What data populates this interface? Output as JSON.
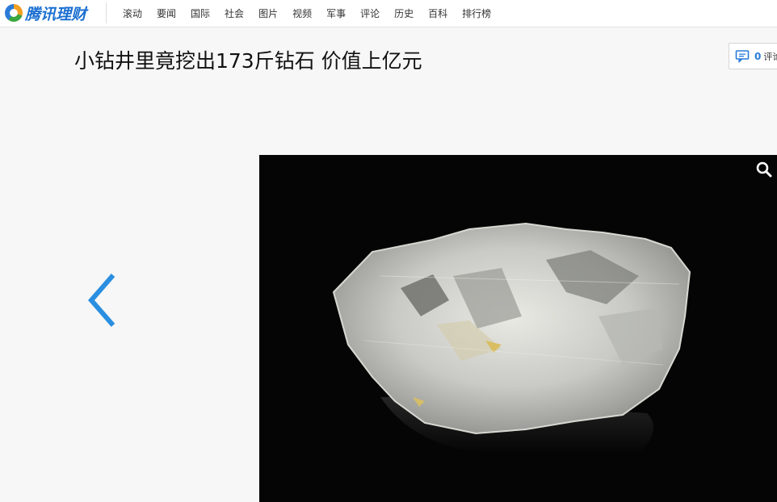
{
  "header": {
    "logo_text": "腾讯理财",
    "nav": [
      "滚动",
      "要闻",
      "国际",
      "社会",
      "图片",
      "视频",
      "军事",
      "评论",
      "历史",
      "百科",
      "排行榜"
    ]
  },
  "article": {
    "title": "小钻井里竟挖出173斤钻石 价值上亿元"
  },
  "comments": {
    "count": "0",
    "label": "评论"
  },
  "icons": {
    "comment": "comment-icon",
    "prev": "chevron-left-icon",
    "zoom": "search-icon"
  },
  "colors": {
    "brand_blue": "#1a6fd1",
    "arrow_blue": "#2a8fe0",
    "page_bg": "#f7f7f7",
    "photo_bg": "#050505"
  }
}
